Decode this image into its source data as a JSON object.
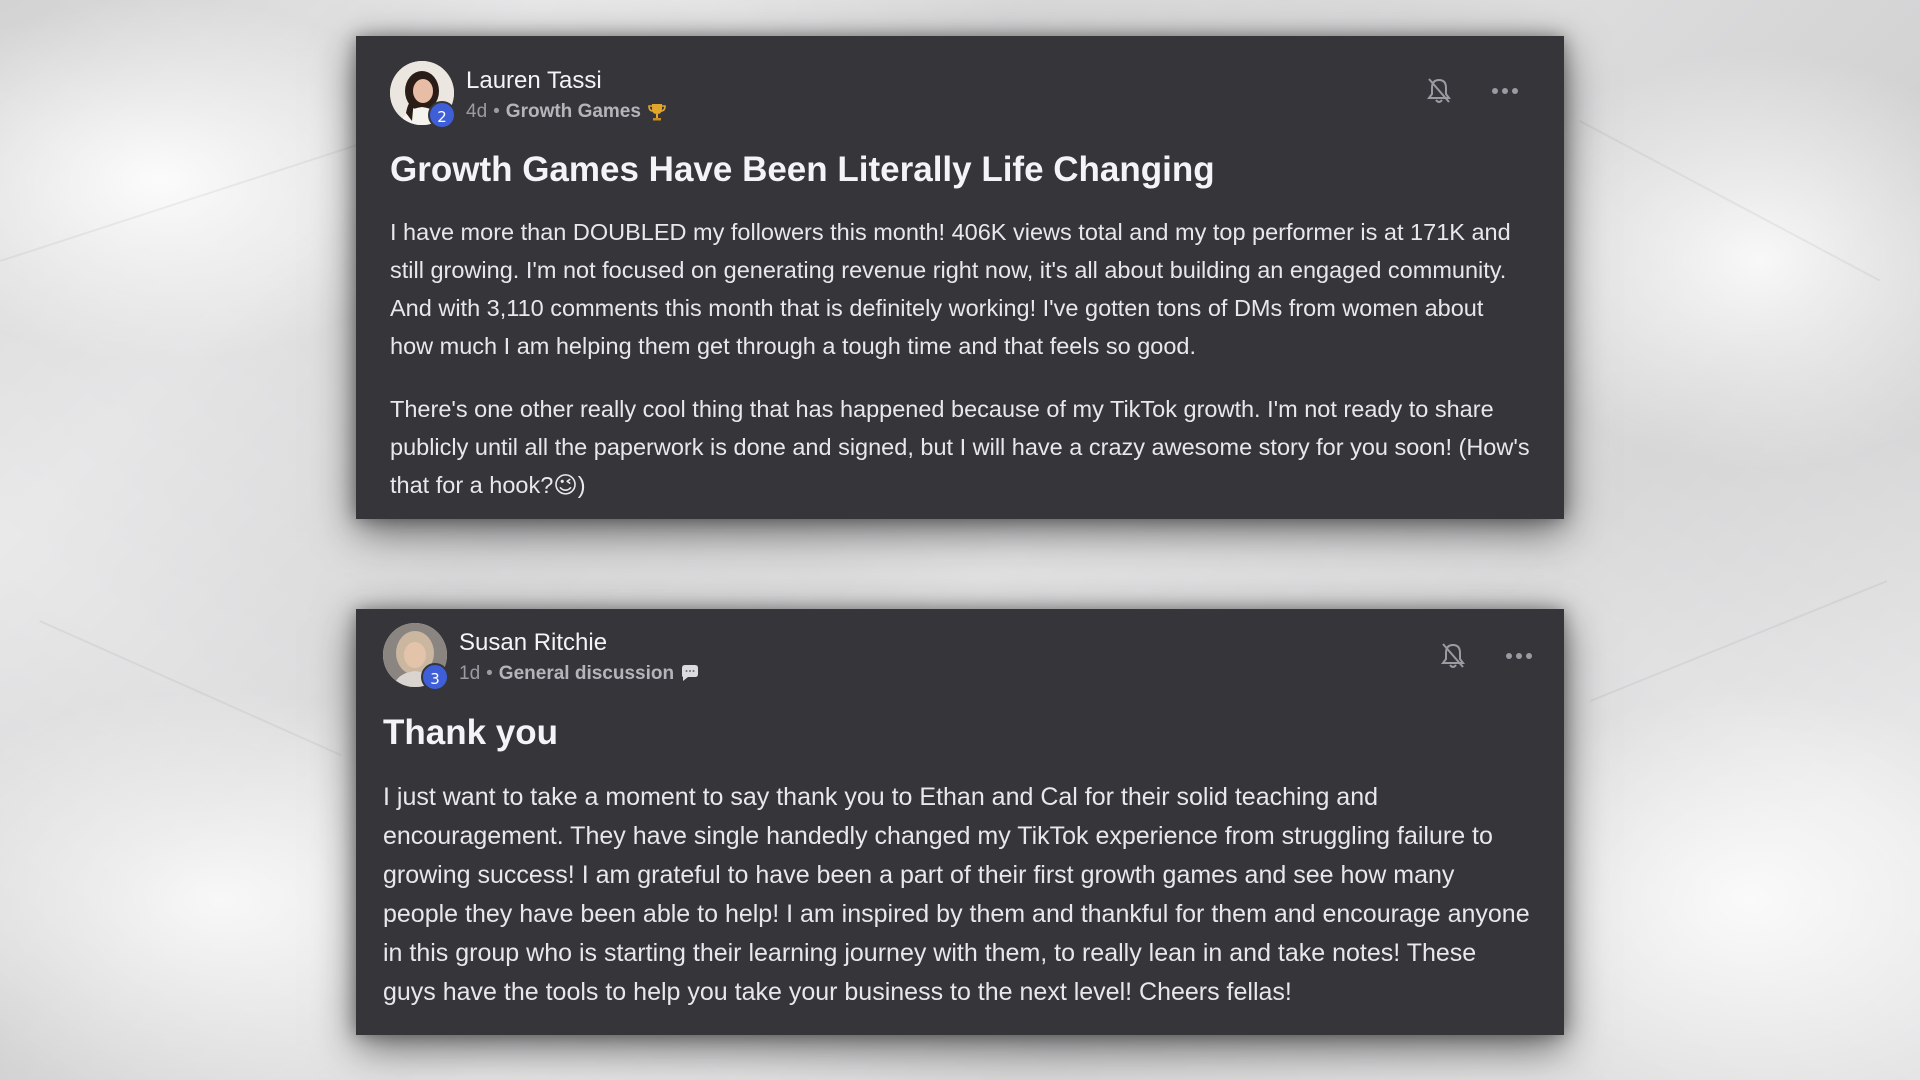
{
  "posts": [
    {
      "author": "Lauren Tassi",
      "level": "2",
      "time": "4d",
      "separator": "•",
      "category": "Growth Games",
      "category_icon": "trophy-icon",
      "title": "Growth Games Have Been Literally Life Changing",
      "paragraphs": [
        "I have more than DOUBLED my followers this month! 406K views total and my top performer is at 171K and still growing. I'm not focused on generating revenue right now, it's all about building an engaged community. And with 3,110 comments this month that is definitely working! I've gotten tons of DMs from women about how much I am helping them get through a tough time and that feels so good.",
        "There's one other really cool thing that has happened because of my TikTok growth. I'm not ready to share publicly until all the paperwork is done and signed, but I will have a crazy awesome story for you soon! (How's that for a hook?😉)"
      ]
    },
    {
      "author": "Susan Ritchie",
      "level": "3",
      "time": "1d",
      "separator": "•",
      "category": "General discussion",
      "category_icon": "speech-bubble-icon",
      "title": "Thank you",
      "paragraphs": [
        "I just want to take a moment to say thank you to Ethan and Cal for their solid teaching and encouragement. They have single handedly changed my TikTok experience from struggling failure to growing success! I am grateful to have been a part of their first growth games and see how many people they have been able to help! I am inspired by them and thankful for them and encourage anyone in this group who is starting their learning journey with them, to really lean in and take notes! These guys have the tools to help you take your business to the next level! Cheers fellas!"
      ]
    }
  ],
  "icons": {
    "bell": "bell-off-icon",
    "more": "more-horizontal-icon"
  },
  "colors": {
    "card_bg": "#36353a",
    "badge": "#3f5fd8",
    "text": "#f1f1f3",
    "meta": "#9c9ba3",
    "trophy": "#e2a52d"
  }
}
